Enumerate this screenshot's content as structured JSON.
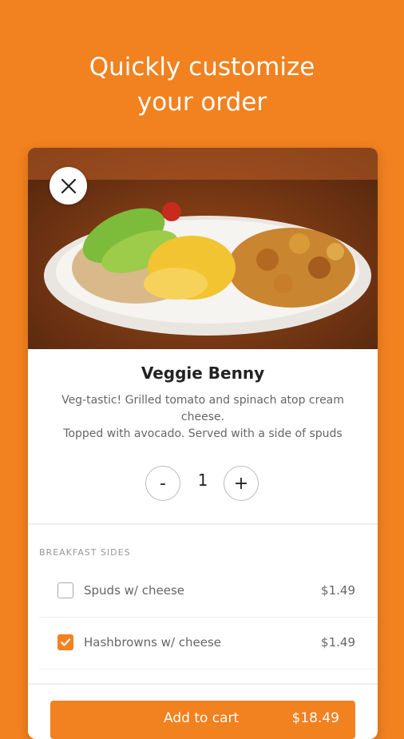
{
  "headline": {
    "line1": "Quickly customize",
    "line2": "your order"
  },
  "item": {
    "photo_icon": "food-photo",
    "close_icon": "close-icon",
    "name": "Veggie Benny",
    "description": {
      "line1": "Veg-tastic! Grilled tomato and spinach atop cream",
      "line2": "cheese.",
      "line3": "Topped with avocado. Served with a side of spuds"
    }
  },
  "quantity": {
    "minus_label": "-",
    "value": "1",
    "plus_label": "+"
  },
  "sides": {
    "title": "BREAKFAST SIDES",
    "options": [
      {
        "label": "Spuds w/ cheese",
        "price": "$1.49",
        "checked": false
      },
      {
        "label": "Hashbrowns w/ cheese",
        "price": "$1.49",
        "checked": true
      }
    ]
  },
  "cart": {
    "label": "Add to cart",
    "total": "$18.49"
  },
  "colors": {
    "accent": "#F2811F"
  }
}
